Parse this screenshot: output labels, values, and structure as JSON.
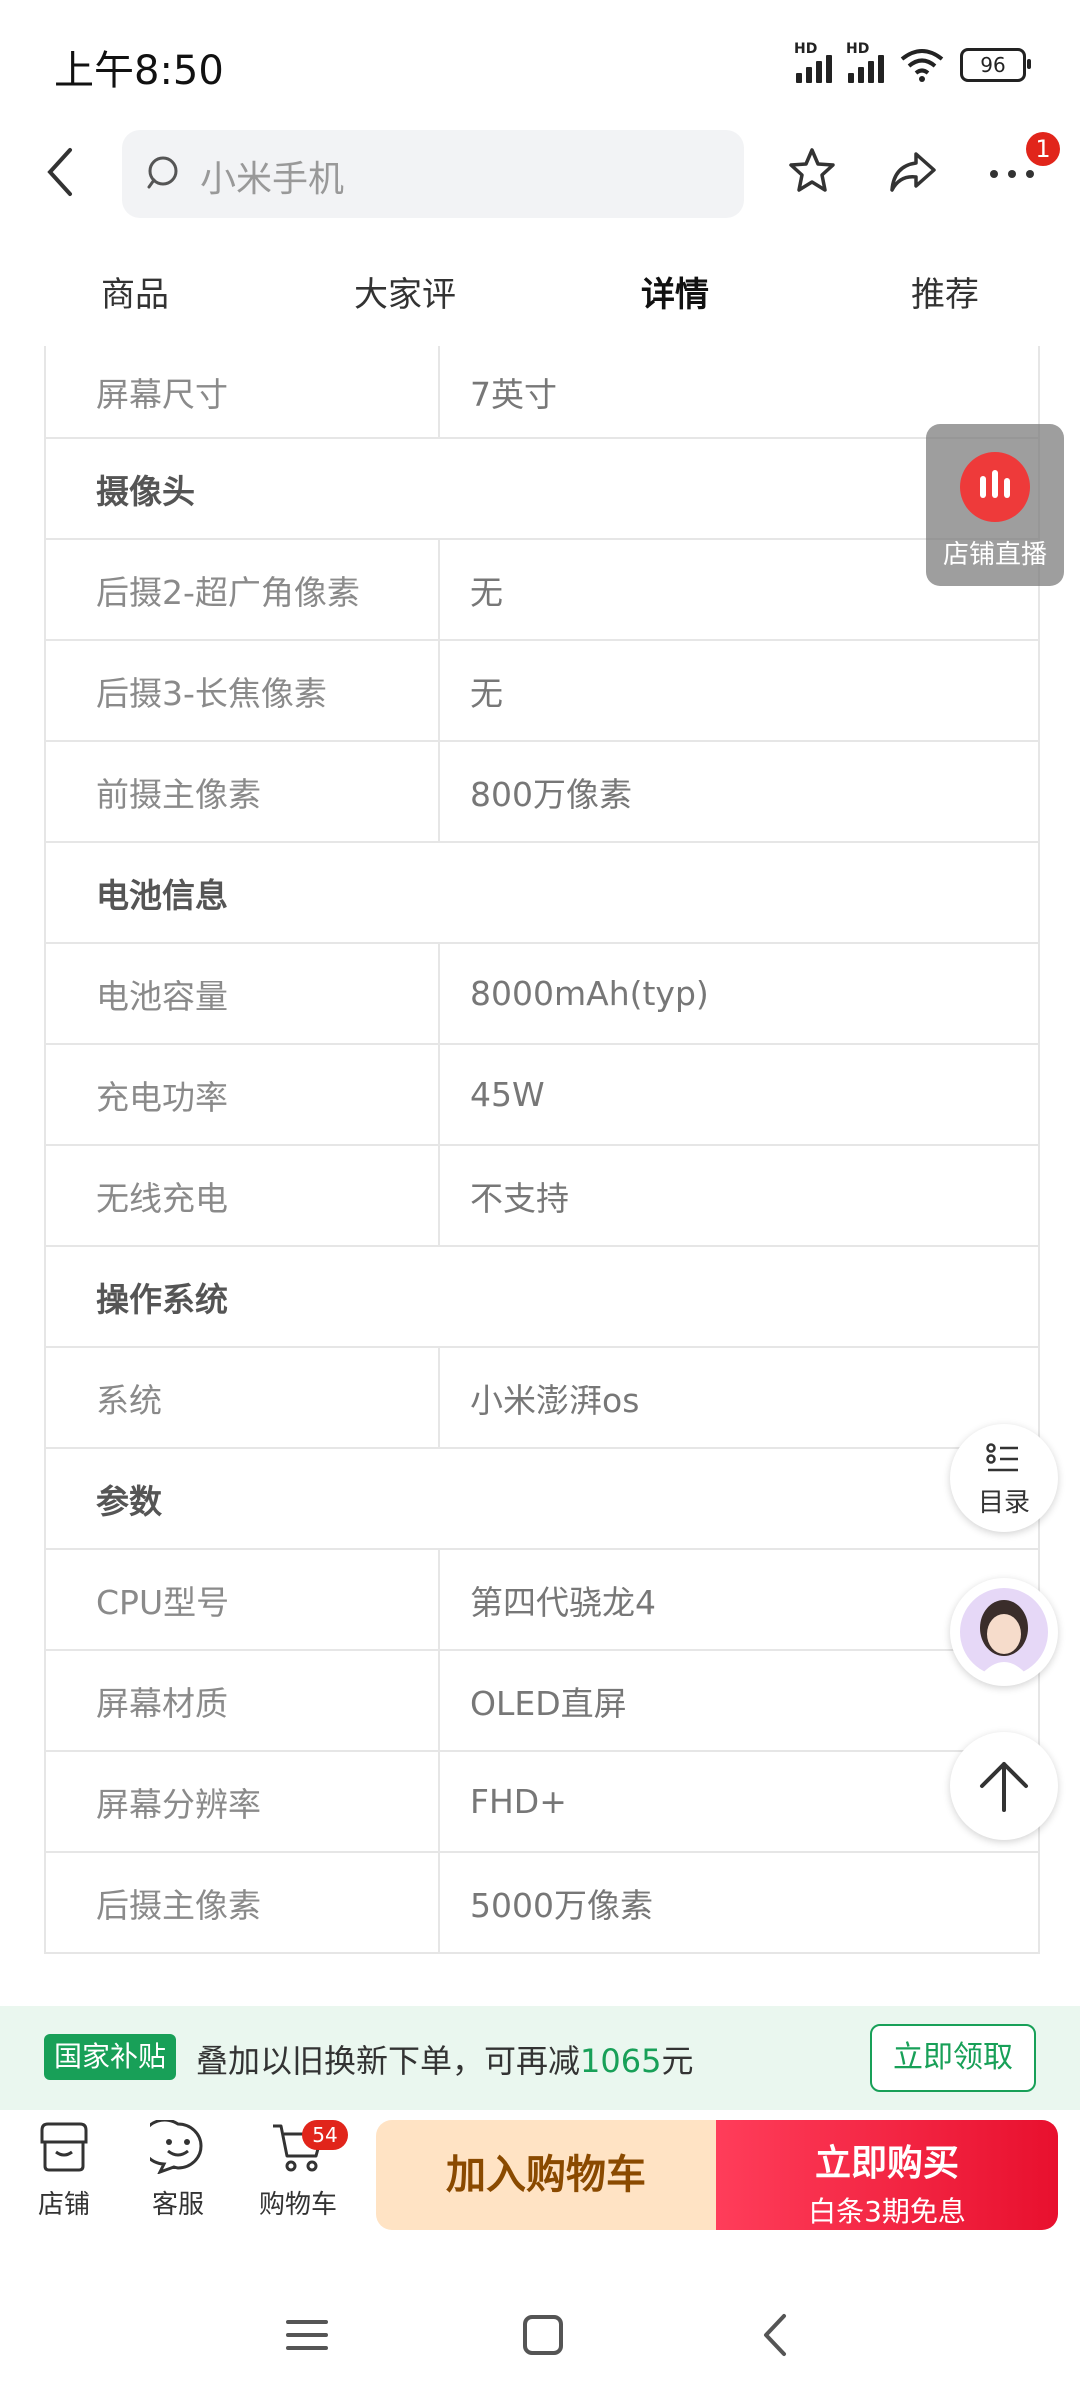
{
  "status_bar": {
    "time": "上午8:50",
    "battery": "96",
    "signal1_label": "HD",
    "signal2_label": "HD"
  },
  "header": {
    "search_placeholder": "小米手机",
    "more_badge": "1"
  },
  "tabs": [
    {
      "label": "商品",
      "active": false
    },
    {
      "label": "大家评",
      "active": false
    },
    {
      "label": "详情",
      "active": true
    },
    {
      "label": "推荐",
      "active": false
    }
  ],
  "specs": [
    {
      "type": "row",
      "key": "屏幕尺寸",
      "value": "7英寸"
    },
    {
      "type": "section",
      "title": "摄像头"
    },
    {
      "type": "row",
      "key": "后摄2-超广角像素",
      "value": "无"
    },
    {
      "type": "row",
      "key": "后摄3-长焦像素",
      "value": "无"
    },
    {
      "type": "row",
      "key": "前摄主像素",
      "value": "800万像素"
    },
    {
      "type": "section",
      "title": "电池信息"
    },
    {
      "type": "row",
      "key": "电池容量",
      "value": "8000mAh(typ)"
    },
    {
      "type": "row",
      "key": "充电功率",
      "value": "45W"
    },
    {
      "type": "row",
      "key": "无线充电",
      "value": "不支持"
    },
    {
      "type": "section",
      "title": "操作系统"
    },
    {
      "type": "row",
      "key": "系统",
      "value": "小米澎湃os"
    },
    {
      "type": "section",
      "title": "参数"
    },
    {
      "type": "row",
      "key": "CPU型号",
      "value": "第四代骁龙4"
    },
    {
      "type": "row",
      "key": "屏幕材质",
      "value": "OLED直屏"
    },
    {
      "type": "row",
      "key": "屏幕分辨率",
      "value": "FHD+"
    },
    {
      "type": "row",
      "key": "后摄主像素",
      "value": "5000万像素"
    }
  ],
  "floating": {
    "live_label": "店铺直播",
    "toc_label": "目录"
  },
  "subsidy": {
    "tag": "国家补贴",
    "text_prefix": "叠加以旧换新下单，可再减",
    "amount": "1065",
    "text_suffix": "元",
    "claim_button": "立即领取"
  },
  "bottom_bar": {
    "store": "店铺",
    "service": "客服",
    "cart": "购物车",
    "cart_count": "54",
    "add_to_cart": "加入购物车",
    "buy_now": "立即购买",
    "buy_now_sub": "白条3期免息"
  },
  "colors": {
    "accent_red": "#e1251b",
    "subsidy_green": "#18a058"
  }
}
